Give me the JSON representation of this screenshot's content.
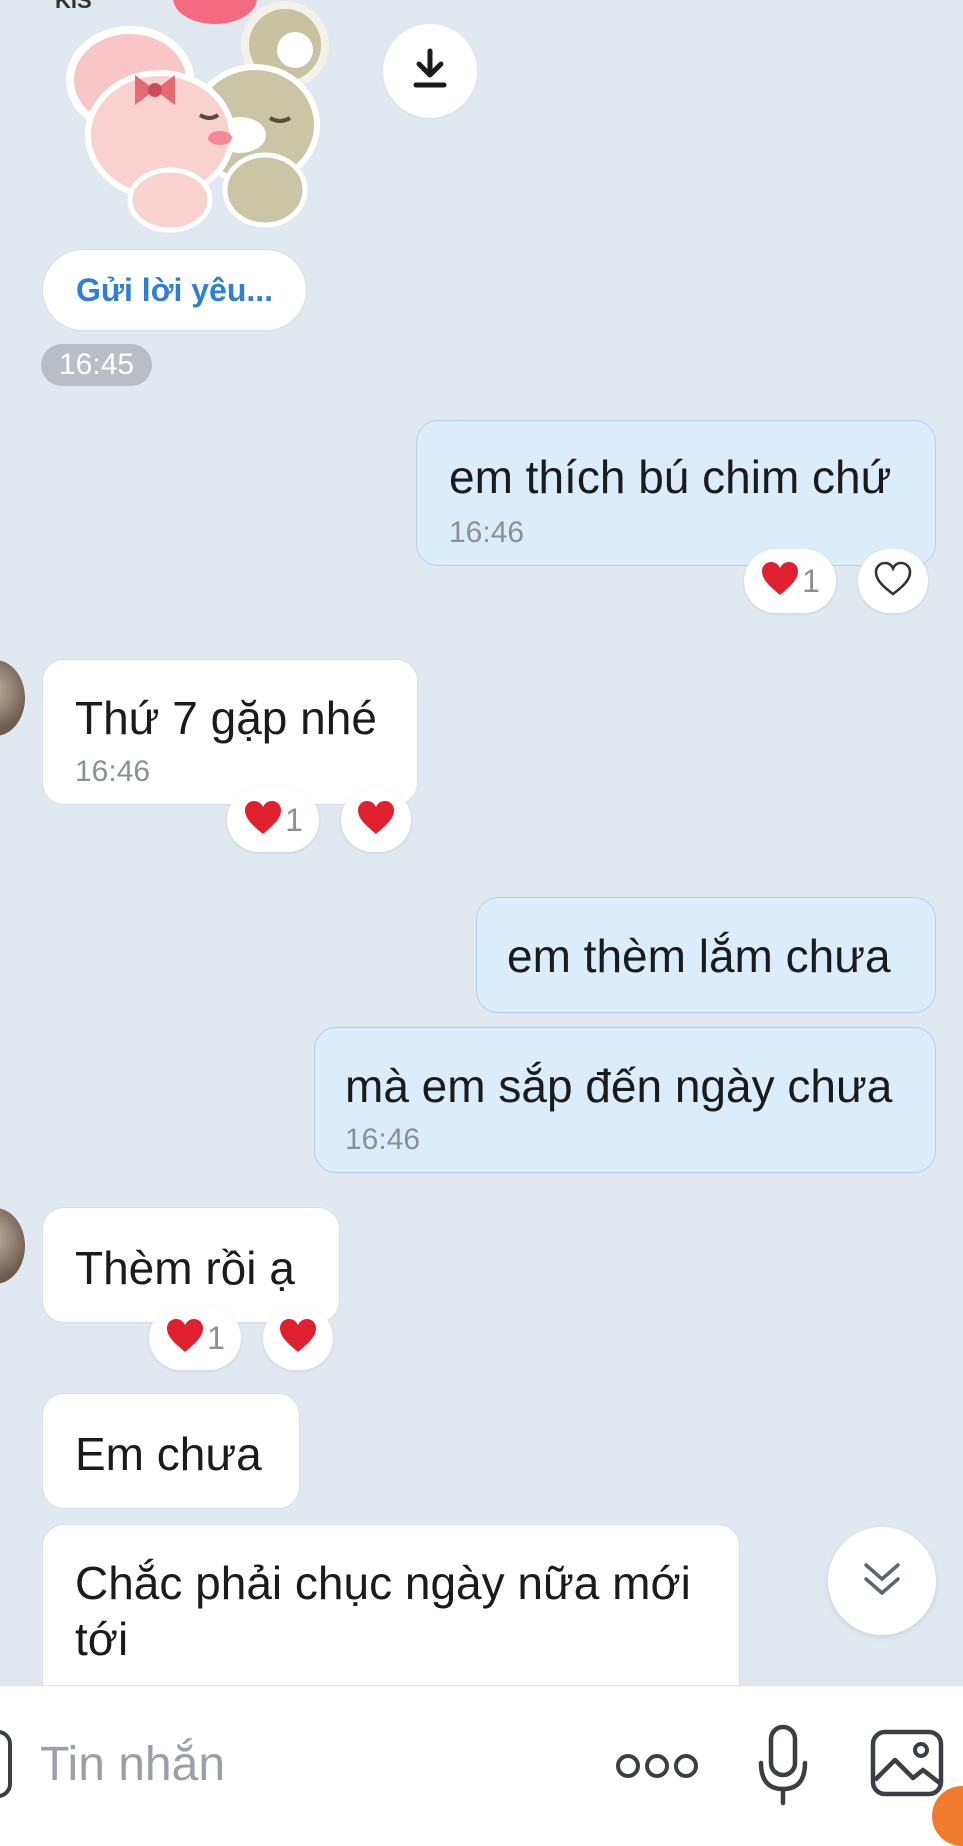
{
  "sticker": {
    "top_text": "KIS"
  },
  "link_preview": {
    "label": "Gửi lời yêu..."
  },
  "timestamps": {
    "sticker_time": "16:45"
  },
  "messages": [
    {
      "dir": "out",
      "text": "em thích bú chim chứ",
      "time": "16:46",
      "reaction_count": "1"
    },
    {
      "dir": "in",
      "text": "Thứ 7 gặp nhé",
      "time": "16:46",
      "reaction_count": "1"
    },
    {
      "dir": "out",
      "text": "em thèm lắm chưa"
    },
    {
      "dir": "out",
      "text": "mà em sắp đến ngày chưa",
      "time": "16:46"
    },
    {
      "dir": "in",
      "text": "Thèm rồi ạ",
      "reaction_count": "1"
    },
    {
      "dir": "in",
      "text": "Em chưa"
    },
    {
      "dir": "in",
      "text_line1": "Chắc phải chục ngày nữa mới",
      "text_line2": "tới"
    }
  ],
  "composer": {
    "placeholder": "Tin nhắn"
  },
  "colors": {
    "background": "#e2e8f0",
    "outgoing_bubble": "#dbecfb",
    "incoming_bubble": "#ffffff",
    "link": "#2f7fd6",
    "heart": "#e0202e"
  },
  "icons": {
    "download": "download-icon",
    "heart_outline": "heart-outline-icon",
    "heart_filled": "heart-filled-icon",
    "scroll_down": "chevron-double-down-icon",
    "more": "more-dots-icon",
    "mic": "microphone-icon",
    "image": "image-icon"
  }
}
